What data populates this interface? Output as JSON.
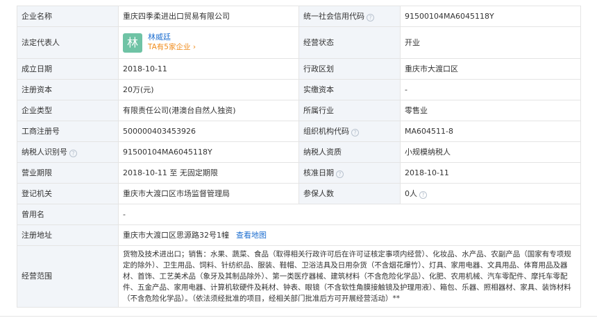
{
  "rows": {
    "name": {
      "label": "企业名称",
      "value": "重庆四季柔进出口贸易有限公司",
      "label2": "统一社会信用代码",
      "value2": "91500104MA6045118Y"
    },
    "legal": {
      "label": "法定代表人",
      "avatar": "林",
      "person": "林威廷",
      "link": "TA有5家企业",
      "label2": "经营状态",
      "value2": "开业"
    },
    "founded": {
      "label": "成立日期",
      "value": "2018-10-11",
      "label2": "行政区划",
      "value2": "重庆市大渡口区"
    },
    "capital": {
      "label": "注册资本",
      "value": "20万(元)",
      "label2": "实缴资本",
      "value2": "-"
    },
    "type": {
      "label": "企业类型",
      "value": "有限责任公司(港澳台自然人独资)",
      "label2": "所属行业",
      "value2": "零售业"
    },
    "regno": {
      "label": "工商注册号",
      "value": "500000403453926",
      "label2": "组织机构代码",
      "value2": "MA604511-8"
    },
    "taxid": {
      "label": "纳税人识别号",
      "value": "91500104MA6045118Y",
      "label2": "纳税人资质",
      "value2": "小规模纳税人"
    },
    "term": {
      "label": "营业期限",
      "value": "2018-10-11 至 无固定期限",
      "label2": "核准日期",
      "value2": "2018-10-11"
    },
    "authority": {
      "label": "登记机关",
      "value": "重庆市大渡口区市场监督管理局",
      "label2": "参保人数",
      "value2": "0人"
    },
    "former": {
      "label": "曾用名",
      "value": "-"
    },
    "address": {
      "label": "注册地址",
      "value": "重庆市大渡口区思源路32号1幢",
      "link": "查看地图"
    },
    "scope": {
      "label": "经营范围",
      "value": "货物及技术进出口；销售：水果、蔬菜、食品（取得相关行政许可后在许可证核定事项内经营）、化妆品、水产品、农副产品（国家有专项规定的除外）、卫生用品、饲料、针纺织品、服装、鞋帽、卫浴洁具及日用杂货（不含烟花爆竹）、灯具、家用电器、文具用品、体育用品及器材、首饰、工艺美术品（象牙及其制品除外）、第一类医疗器械、建筑材料（不含危险化学品）、化肥、农用机械、汽车零配件、摩托车零配件、五金产品、家用电器、计算机软硬件及耗材、钟表、眼镜（不含软性角膜接触镜及护理用液）、箱包、乐器、照相器材、家具、装饰材料（不含危险化学品）。（依法须经批准的项目，经相关部门批准后方可开展经营活动）**"
    }
  },
  "help_icon": "question-circle-icon",
  "colors": {
    "label_bg": "#f2f5f9",
    "link": "#1e6fd0",
    "orange": "#f08c1c",
    "avatar": "#6fc3a5"
  }
}
